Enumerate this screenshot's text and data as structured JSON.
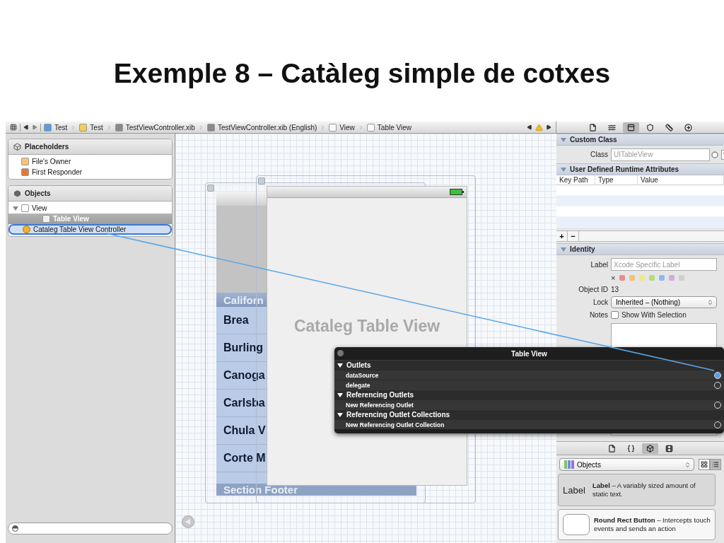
{
  "slide_title": "Exemple 8 – Catàleg simple de cotxes",
  "jump_bar": [
    {
      "label": "Test",
      "kind": "project"
    },
    {
      "label": "Test",
      "kind": "folder"
    },
    {
      "label": "TestViewController.xib",
      "kind": "xib"
    },
    {
      "label": "TestViewController.xib (English)",
      "kind": "xib"
    },
    {
      "label": "View",
      "kind": "view"
    },
    {
      "label": "Table View",
      "kind": "view"
    }
  ],
  "outline": [
    {
      "title": "Placeholders",
      "kind": "placeholders",
      "items": [
        {
          "label": "File's Owner",
          "kind": "owner",
          "selected": false
        },
        {
          "label": "First Responder",
          "kind": "responder",
          "selected": false
        }
      ]
    },
    {
      "title": "Objects",
      "kind": "objects",
      "items": [
        {
          "label": "View",
          "kind": "view",
          "selected": false,
          "expanded": true,
          "children": [
            {
              "label": "Table View",
              "kind": "table",
              "selected": true
            }
          ]
        },
        {
          "label": "Cataleg Table View Controller",
          "kind": "controller",
          "selected": false,
          "drop_target": true
        }
      ]
    }
  ],
  "canvas": {
    "table": {
      "header": "Californ",
      "rows": [
        "Brea",
        "Burling",
        "Canoga",
        "Carlsba",
        "Chula V",
        "Corte M"
      ],
      "footer": "Section Footer"
    },
    "view_label": "Cataleg Table View"
  },
  "inspector": {
    "tabs": [
      {
        "kind": "file",
        "selected": false
      },
      {
        "kind": "help",
        "selected": false
      },
      {
        "kind": "identity",
        "selected": true
      },
      {
        "kind": "attributes",
        "selected": false
      },
      {
        "kind": "size",
        "selected": false
      },
      {
        "kind": "connections",
        "selected": false
      }
    ],
    "custom_class": {
      "title": "Custom Class",
      "expanded": true,
      "class_caption": "Class",
      "class_placeholder": "UITableView"
    },
    "runtime_attributes": {
      "title": "User Defined Runtime Attributes",
      "expanded": true,
      "columns": [
        "Key Path",
        "Type",
        "Value"
      ],
      "add": "+",
      "remove": "−"
    },
    "identity": {
      "title": "Identity",
      "expanded": true,
      "label_caption": "Label",
      "label_placeholder": "Xcode Specific Label",
      "clear_color": "×",
      "colors": [
        {
          "color": "#ee8a8a"
        },
        {
          "color": "#f3c27a"
        },
        {
          "color": "#eeea85"
        },
        {
          "color": "#b7dc7e"
        },
        {
          "color": "#8fb9ee"
        },
        {
          "color": "#d6a9e0"
        },
        {
          "color": "#cfcfcf"
        }
      ],
      "object_id_caption": "Object ID",
      "object_id": "13",
      "lock_caption": "Lock",
      "lock": "Inherited – (Nothing)",
      "notes_caption": "Notes",
      "show_with_selection": {
        "label": "Show With Selection",
        "checked": false
      }
    }
  },
  "connections": {
    "title": "Table View",
    "sections": [
      {
        "title": "Outlets",
        "expanded": true,
        "items": [
          {
            "label": "dataSource",
            "connected": true
          },
          {
            "label": "delegate",
            "connected": false
          }
        ]
      },
      {
        "title": "Referencing Outlets",
        "expanded": true,
        "items": [
          {
            "label": "New Referencing Outlet",
            "connected": false
          }
        ]
      },
      {
        "title": "Referencing Outlet Collections",
        "expanded": true,
        "items": [
          {
            "label": "New Referencing Outlet Collection",
            "connected": false
          }
        ]
      }
    ]
  },
  "library": {
    "tabs": [
      {
        "kind": "file",
        "selected": false
      },
      {
        "kind": "code",
        "selected": false
      },
      {
        "kind": "objects",
        "selected": true
      },
      {
        "kind": "media",
        "selected": false
      }
    ],
    "filter": "Objects",
    "view_buttons": [
      {
        "kind": "grid",
        "selected": false
      },
      {
        "kind": "list",
        "selected": true
      }
    ],
    "items": [
      {
        "kind": "label",
        "preview": "Label",
        "text": "**Label** – A variably sized amount of static text.",
        "selected": true
      },
      {
        "kind": "button",
        "text": "**Round Rect Button** – Intercepts touch events and sends an action",
        "selected": false
      }
    ]
  }
}
